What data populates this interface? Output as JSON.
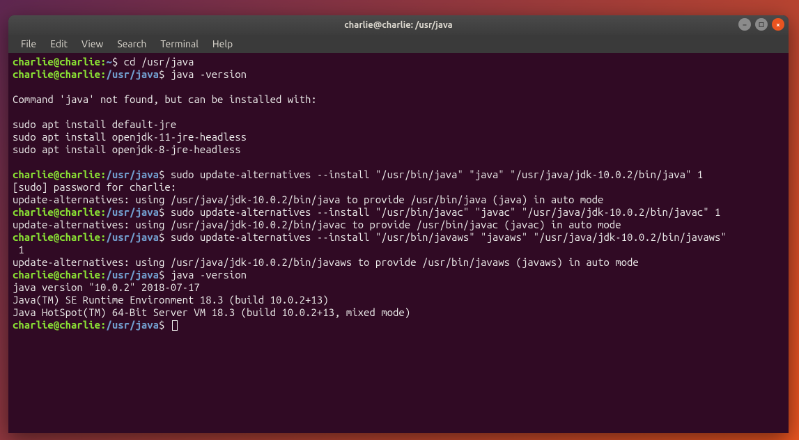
{
  "titlebar": {
    "title": "charlie@charlie: /usr/java"
  },
  "menu": {
    "items": [
      "File",
      "Edit",
      "View",
      "Search",
      "Terminal",
      "Help"
    ]
  },
  "prompt": {
    "userhost": "charlie@charlie",
    "colon": ":",
    "home": "~",
    "path": "/usr/java",
    "dollar": "$"
  },
  "lines": {
    "cmd1": " cd /usr/java",
    "cmd2": " java -version",
    "blank": " ",
    "out_notfound": "Command 'java' not found, but can be installed with:",
    "out_sudo1": "sudo apt install default-jre",
    "out_sudo2": "sudo apt install openjdk-11-jre-headless",
    "out_sudo3": "sudo apt install openjdk-8-jre-headless",
    "cmd3": " sudo update-alternatives --install \"/usr/bin/java\" \"java\" \"/usr/java/jdk-10.0.2/bin/java\" 1",
    "out_pwd": "[sudo] password for charlie:",
    "out_alt1": "update-alternatives: using /usr/java/jdk-10.0.2/bin/java to provide /usr/bin/java (java) in auto mode",
    "cmd4": " sudo update-alternatives --install \"/usr/bin/javac\" \"javac\" \"/usr/java/jdk-10.0.2/bin/javac\" 1",
    "out_alt2": "update-alternatives: using /usr/java/jdk-10.0.2/bin/javac to provide /usr/bin/javac (javac) in auto mode",
    "cmd5a": " sudo update-alternatives --install \"/usr/bin/javaws\" \"javaws\" \"/usr/java/jdk-10.0.2/bin/javaws\"",
    "cmd5b": " 1",
    "out_alt3": "update-alternatives: using /usr/java/jdk-10.0.2/bin/javaws to provide /usr/bin/javaws (javaws) in auto mode",
    "cmd6": " java -version",
    "out_jv1": "java version \"10.0.2\" 2018-07-17",
    "out_jv2": "Java(TM) SE Runtime Environment 18.3 (build 10.0.2+13)",
    "out_jv3": "Java HotSpot(TM) 64-Bit Server VM 18.3 (build 10.0.2+13, mixed mode)"
  }
}
